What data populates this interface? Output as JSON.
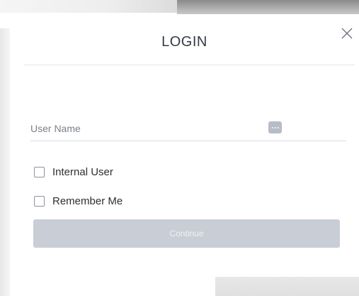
{
  "dialog": {
    "title": "LOGIN",
    "close_icon": "close-icon"
  },
  "username": {
    "placeholder": "User Name",
    "value": "",
    "trailing_icon": "more-dots-icon"
  },
  "options": {
    "internal_user": {
      "label": "Internal User",
      "checked": false
    },
    "remember_me": {
      "label": "Remember Me",
      "checked": false
    }
  },
  "actions": {
    "continue_label": "Continue",
    "continue_enabled": false
  },
  "colors": {
    "title_text": "#333a44",
    "divider": "#e4e6ea",
    "button_disabled_bg": "#c9ced6",
    "button_disabled_text": "#eef0f3",
    "dots_icon_bg": "#b7bcc6"
  }
}
